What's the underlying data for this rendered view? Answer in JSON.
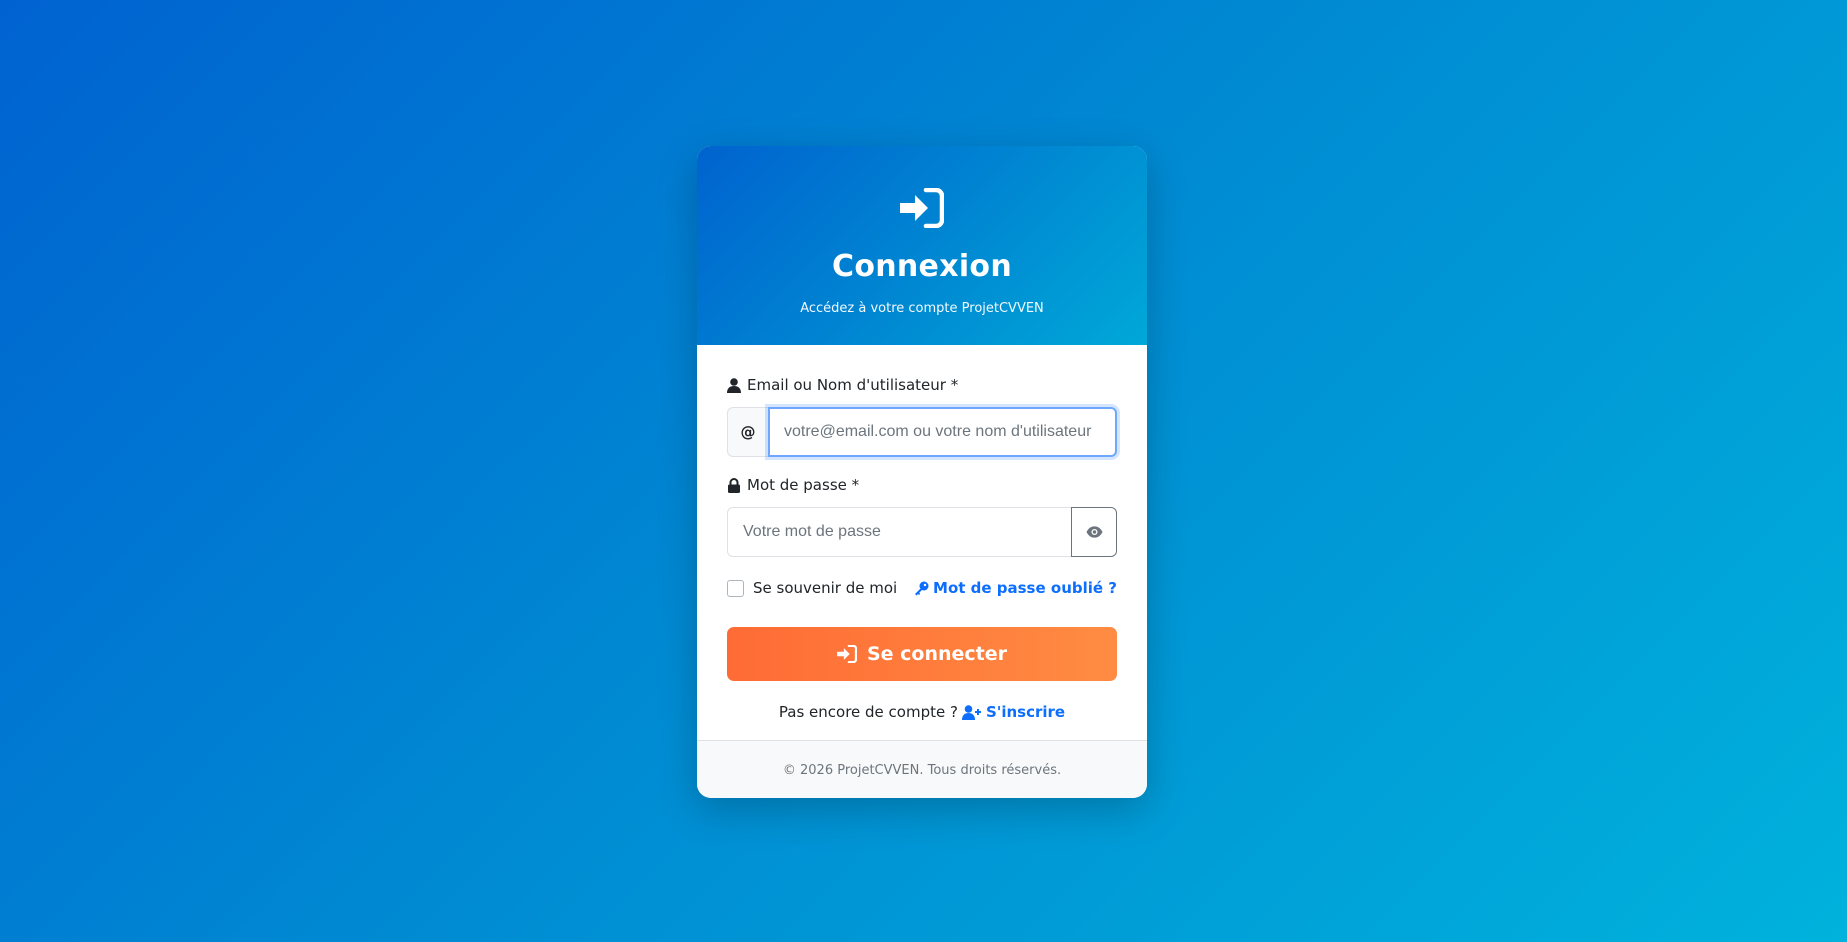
{
  "header": {
    "icon": "sign-in-icon",
    "title": "Connexion",
    "subtitle": "Accédez à votre compte ProjetCVVEN"
  },
  "form": {
    "login_label": "Email ou Nom d'utilisateur *",
    "login_icon": "user-icon",
    "login_addon": "@",
    "login_placeholder": "votre@email.com ou votre nom d'utilisateur",
    "login_value": "",
    "password_label": "Mot de passe *",
    "password_icon": "lock-icon",
    "password_placeholder": "Votre mot de passe",
    "password_value": "",
    "toggle_icon": "eye-icon",
    "remember_label": "Se souvenir de moi",
    "remember_checked": false,
    "forgot_icon": "key-icon",
    "forgot_label": "Mot de passe oublié ?",
    "submit_icon": "sign-in-icon",
    "submit_label": "Se connecter",
    "signup_prompt": "Pas encore de compte ?",
    "signup_icon": "user-plus-icon",
    "signup_label": "S'inscrire"
  },
  "footer": {
    "text": "© 2026 ProjetCVVEN. Tous droits réservés."
  },
  "colors": {
    "accent": "#0d6efd",
    "button_start": "#ff6b35",
    "button_end": "#ff8c42",
    "header_start": "#0063cf",
    "header_end": "#00a8d8"
  }
}
